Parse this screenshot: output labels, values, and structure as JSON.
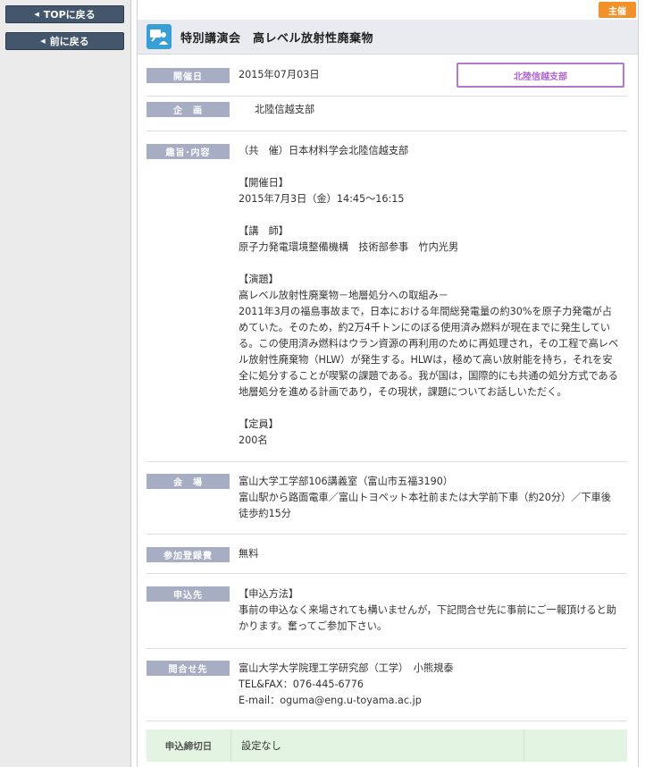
{
  "nav": {
    "top_label": "TOPに戻る",
    "prev_label": "前に戻る"
  },
  "badge": {
    "host_label": "主催"
  },
  "title": {
    "text": "特別講演会　高レベル放射性廃棄物",
    "icon": "event-lecture-icon"
  },
  "colors": {
    "nav_bg": "#44566b",
    "label_bg": "#a7aec3",
    "host_badge": "#f0912a",
    "branch_border": "#b477d0",
    "deadline_bg": "#e4f4e2",
    "title_icon": "#3a9ed6"
  },
  "details": {
    "date": {
      "label": "開催日",
      "value": "2015年07月03日",
      "branch": "北陸信越支部"
    },
    "planning": {
      "label": "企　画",
      "value": "北陸信越支部"
    },
    "content": {
      "label": "趣旨･内容",
      "cohost": "（共　催）日本材料学会北陸信越支部",
      "date_heading": "【開催日】",
      "date_value": "2015年7月3日（金）14:45～16:15",
      "lecturer_heading": "【講　師】",
      "lecturer_value": "原子力発電環境整備機構　技術部参事　竹内光男",
      "topic_heading": "【演題】",
      "topic_title": "高レベル放射性廃棄物－地層処分への取組み－",
      "topic_line1": "2011年3月の福島事故まで，日本における年間総発電量の約30%を原子力発電が占",
      "topic_line2": "めていた。そのため，約2万4千トンにのぼる使用済み燃料が現在までに発生してい",
      "topic_line3": "る。この使用済み燃料はウラン資源の再利用のために再処理され，その工程で高レベ",
      "topic_line4": "ル放射性廃棄物（HLW）が発生する。HLWは，極めて高い放射能を持ち，それを安",
      "topic_line5": "全に処分することが喫緊の課題である。我が国は，国際的にも共通の処分方式である",
      "topic_line6": "地層処分を進める計画であり，その現状，課題についてお話しいただく。",
      "capacity_heading": "【定員】",
      "capacity_value": "200名"
    },
    "venue": {
      "label": "会　場",
      "line1": "富山大学工学部106講義室（富山市五福3190）",
      "line2": "富山駅から路面電車／富山トヨペット本社前または大学前下車（約20分）／下車後",
      "line3": "徒歩約15分"
    },
    "fee": {
      "label": "参加登録費",
      "value": "無料"
    },
    "apply": {
      "label": "申込先",
      "heading": "【申込方法】",
      "line1": "事前の申込なく来場されても構いませんが，下記問合せ先に事前にご一報頂けると助",
      "line2": "かります。奮ってご参加下さい。"
    },
    "contact": {
      "label": "問合せ先",
      "line1": "富山大学大学院理工学研究部（工学）　小熊規泰",
      "line2": "TEL&FAX：076-445-6776",
      "line3": "E-mail：oguma@eng.u-toyama.ac.jp"
    },
    "deadline": {
      "label": "申込締切日",
      "value": "設定なし"
    }
  }
}
